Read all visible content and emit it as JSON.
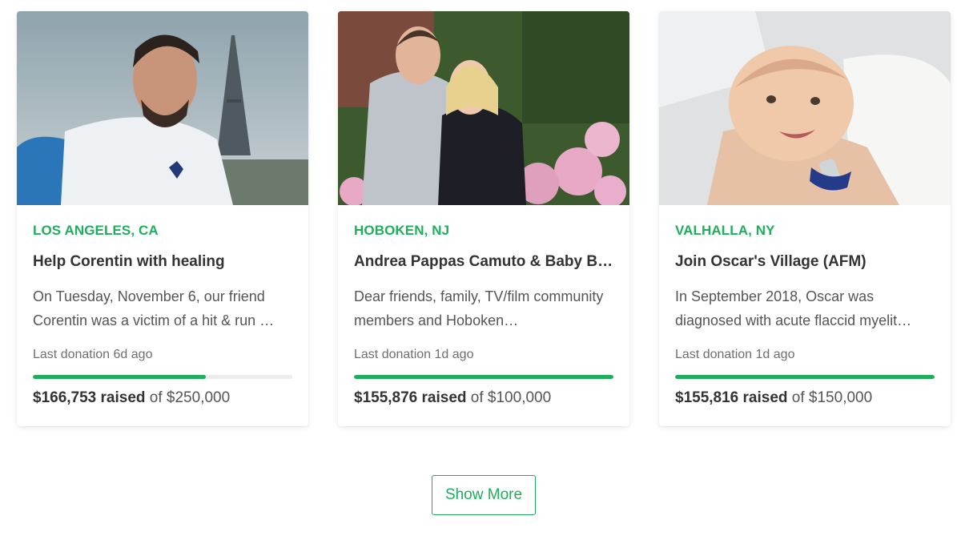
{
  "campaigns": [
    {
      "location": "LOS ANGELES, CA",
      "title": "Help Corentin with healing",
      "description": "On Tuesday, November 6, our friend Corentin was a victim of a hit & run …",
      "last_donation": "Last donation 6d ago",
      "raised": "$166,753 raised",
      "goal": "of $250,000",
      "progress": 0.667
    },
    {
      "location": "HOBOKEN, NJ",
      "title": "Andrea Pappas Camuto & Baby Bl…",
      "description": "Dear friends, family, TV/film community members and Hoboken…",
      "last_donation": "Last donation 1d ago",
      "raised": "$155,876 raised",
      "goal": "of $100,000",
      "progress": 1.0
    },
    {
      "location": "VALHALLA, NY",
      "title": "Join Oscar's Village (AFM)",
      "description": "In September 2018, Oscar was diagnosed with acute flaccid myelit…",
      "last_donation": "Last donation 1d ago",
      "raised": "$155,816 raised",
      "goal": "of $150,000",
      "progress": 1.0
    }
  ],
  "show_more_label": "Show More",
  "colors": {
    "accent": "#1fae5b",
    "track": "#ececec",
    "title": "#333333",
    "text": "#555555"
  }
}
